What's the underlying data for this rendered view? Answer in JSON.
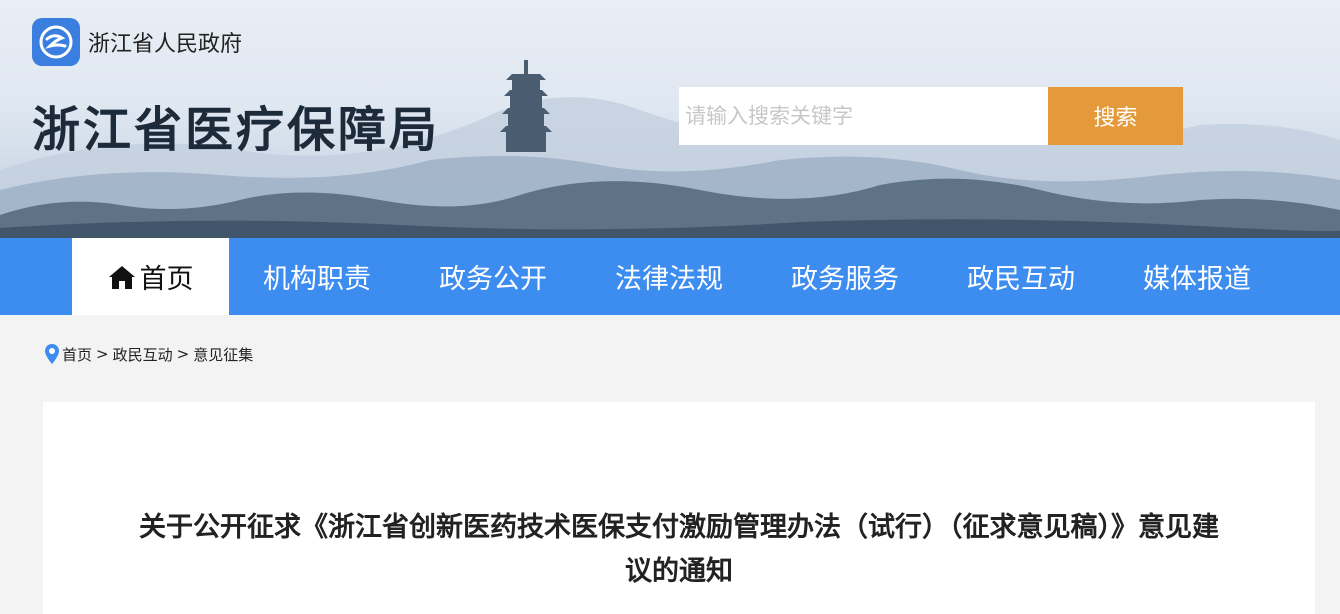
{
  "header": {
    "gov_name": "浙江省人民政府",
    "site_title": "浙江省医疗保障局",
    "search": {
      "placeholder": "请输入搜索关键字",
      "button_label": "搜索"
    }
  },
  "nav": {
    "items": [
      {
        "label": "首页",
        "icon": "home-icon",
        "active": true
      },
      {
        "label": "机构职责"
      },
      {
        "label": "政务公开"
      },
      {
        "label": "法律法规"
      },
      {
        "label": "政务服务"
      },
      {
        "label": "政民互动"
      },
      {
        "label": "媒体报道"
      }
    ]
  },
  "breadcrumb": {
    "icon": "location-pin-icon",
    "items": [
      "首页",
      "政民互动",
      "意见征集"
    ],
    "separator": ">"
  },
  "article": {
    "title": "关于公开征求《浙江省创新医药技术医保支付激励管理办法（试行）（征求意见稿）》意见建议的通知"
  },
  "colors": {
    "nav_bg": "#3d8cf0",
    "search_button": "#e49a3a",
    "page_bg": "#f3f3f3"
  }
}
